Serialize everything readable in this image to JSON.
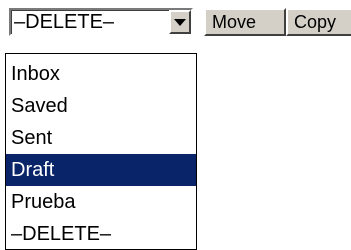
{
  "folder_select": {
    "value": "–DELETE–"
  },
  "buttons": {
    "move_label": "Move",
    "copy_label": "Copy"
  },
  "dropdown": {
    "options": [
      "Inbox",
      "Saved",
      "Sent",
      "Draft",
      "Prueba",
      "–DELETE–"
    ],
    "highlighted": "Draft"
  },
  "colors": {
    "highlight_bg": "#0a246a",
    "highlight_text": "#ffffff",
    "button_face": "#d4d0c8"
  }
}
